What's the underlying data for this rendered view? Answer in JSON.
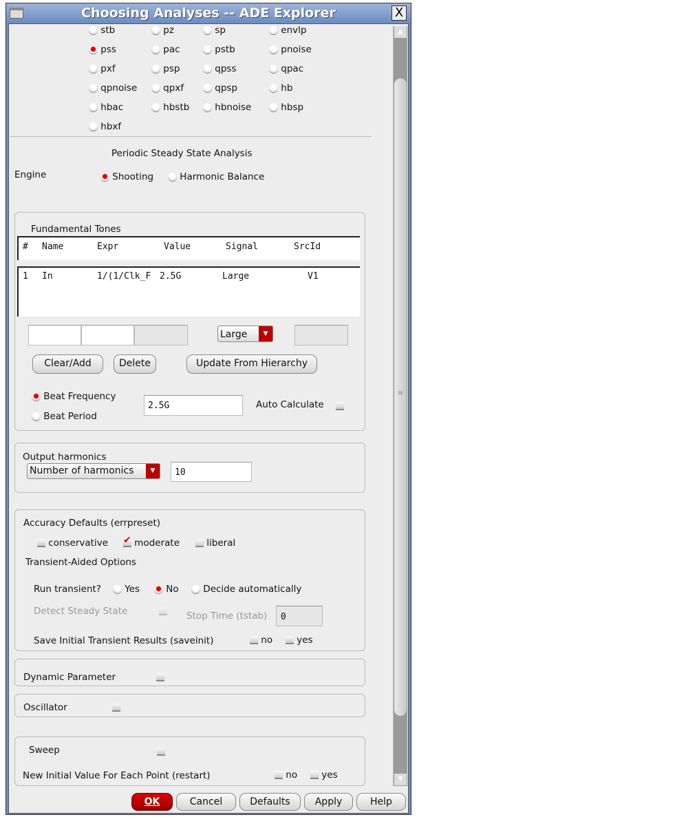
{
  "window": {
    "title": "Choosing Analyses -- ADE Explorer",
    "close": "X"
  },
  "analyses": [
    {
      "label": "stb",
      "selected": false
    },
    {
      "label": "pz",
      "selected": false
    },
    {
      "label": "sp",
      "selected": false
    },
    {
      "label": "envlp",
      "selected": false
    },
    {
      "label": "pss",
      "selected": true
    },
    {
      "label": "pac",
      "selected": false
    },
    {
      "label": "pstb",
      "selected": false
    },
    {
      "label": "pnoise",
      "selected": false
    },
    {
      "label": "pxf",
      "selected": false
    },
    {
      "label": "psp",
      "selected": false
    },
    {
      "label": "qpss",
      "selected": false
    },
    {
      "label": "qpac",
      "selected": false
    },
    {
      "label": "qpnoise",
      "selected": false
    },
    {
      "label": "qpxf",
      "selected": false
    },
    {
      "label": "qpsp",
      "selected": false
    },
    {
      "label": "hb",
      "selected": false
    },
    {
      "label": "hbac",
      "selected": false
    },
    {
      "label": "hbstb",
      "selected": false
    },
    {
      "label": "hbnoise",
      "selected": false
    },
    {
      "label": "hbsp",
      "selected": false
    },
    {
      "label": "hbxf",
      "selected": false
    }
  ],
  "pss": {
    "heading": "Periodic Steady State Analysis",
    "engine_label": "Engine",
    "engine_options": [
      "Shooting",
      "Harmonic Balance"
    ],
    "engine_selected": "Shooting",
    "tones": {
      "title": "Fundamental Tones",
      "columns": [
        "#",
        "Name",
        "Expr",
        "Value",
        "Signal",
        "SrcId"
      ],
      "rows": [
        [
          "1",
          "In",
          "1/(1/Clk_F",
          "2.5G",
          "Large",
          "V1"
        ]
      ],
      "signal_select": "Large",
      "buttons": [
        "Clear/Add",
        "Delete",
        "Update From Hierarchy"
      ],
      "beat_frequency": "Beat Frequency",
      "beat_period": "Beat Period",
      "beat_value": "2.5G",
      "auto_calculate": "Auto Calculate"
    },
    "harmonics": {
      "title": "Output harmonics",
      "select": "Number of harmonics",
      "value": "10"
    },
    "accuracy": {
      "title": "Accuracy Defaults (errpreset)",
      "options": [
        "conservative",
        "moderate",
        "liberal"
      ],
      "selected": "moderate"
    },
    "transient": {
      "title": "Transient-Aided Options",
      "run_label": "Run transient?",
      "run_options": [
        "Yes",
        "No",
        "Decide automatically"
      ],
      "run_selected": "No",
      "detect": "Detect Steady State",
      "stop_time_label": "Stop Time (tstab)",
      "stop_time_value": "0",
      "saveinit": "Save Initial Transient Results (saveinit)",
      "no": "no",
      "yes": "yes"
    },
    "dynamic": "Dynamic Parameter",
    "oscillator": "Oscillator",
    "sweep": {
      "label": "Sweep",
      "restart": "New Initial Value For Each Point (restart)",
      "no": "no",
      "yes": "yes"
    }
  },
  "footer": {
    "ok": "OK",
    "cancel": "Cancel",
    "defaults": "Defaults",
    "apply": "Apply",
    "help": "Help"
  }
}
